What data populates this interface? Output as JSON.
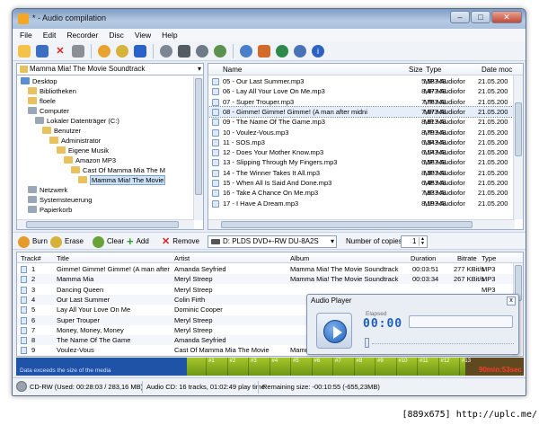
{
  "window": {
    "title": "* - Audio compilation",
    "controls": [
      "–",
      "□",
      "✕"
    ]
  },
  "menu": [
    "File",
    "Edit",
    "Recorder",
    "Disc",
    "View",
    "Help"
  ],
  "folder_combo": "Mamma Mia! The Movie Soundtrack",
  "tree": [
    {
      "label": "Desktop",
      "icon": "blue"
    },
    {
      "label": "Bibliotheken",
      "icon": "yellow"
    },
    {
      "label": "floele",
      "icon": "yellow"
    },
    {
      "label": "Computer",
      "icon": "grey"
    },
    {
      "label": "Lokaler Datenträger (C:)",
      "icon": "grey"
    },
    {
      "label": "Benutzer",
      "icon": "yellow"
    },
    {
      "label": "Administrator",
      "icon": "yellow"
    },
    {
      "label": "Eigene Musik",
      "icon": "yellow"
    },
    {
      "label": "Amazon MP3",
      "icon": "yellow"
    },
    {
      "label": "Cast Of Mamma Mia The M",
      "icon": "yellow"
    },
    {
      "label": "Mamma Mia! The Movie",
      "icon": "yellow"
    },
    {
      "label": "Netzwerk",
      "icon": "grey"
    },
    {
      "label": "Systemsteuerung",
      "icon": "grey"
    },
    {
      "label": "Papierkorb",
      "icon": "grey"
    }
  ],
  "file_headers": {
    "name": "Name",
    "size": "Size",
    "type": "Type",
    "date": "Date moc"
  },
  "files": [
    {
      "name": "05 - Our Last Summer.mp3",
      "size": "5,58 MB",
      "type": "MP3-Audiofor",
      "date": "21.05.200"
    },
    {
      "name": "06 - Lay All Your Love On Me.mp3",
      "size": "8,47 MB",
      "type": "MP3-Audiofor",
      "date": "21.05.200"
    },
    {
      "name": "07 - Super Trouper.mp3",
      "size": "7,76 MB",
      "type": "MP3-Audiofor",
      "date": "21.05.200"
    },
    {
      "name": "08 - Gimme! Gimme! Gimme! (A man after midni",
      "size": "7,67 MB",
      "type": "MP3-Audiofor",
      "date": "21.05.200"
    },
    {
      "name": "09 - The Name Of The Game.mp3",
      "size": "8,81 MB",
      "type": "MP3-Audiofor",
      "date": "21.05.200"
    },
    {
      "name": "10 - Voulez-Vous.mp3",
      "size": "8,79 MB",
      "type": "MP3-Audiofor",
      "date": "21.05.200"
    },
    {
      "name": "11 - SOS.mp3",
      "size": "6,34 MB",
      "type": "MP3-Audiofor",
      "date": "21.05.200"
    },
    {
      "name": "12 - Does Your Mother Know.mp3",
      "size": "6,14 MB",
      "type": "MP3-Audiofor",
      "date": "21.05.200"
    },
    {
      "name": "13 - Slipping Through My Fingers.mp3",
      "size": "6,56 MB",
      "type": "MP3-Audiofor",
      "date": "21.05.200"
    },
    {
      "name": "14 - The Winner Takes It All.mp3",
      "size": "8,30 MB",
      "type": "MP3-Audiofor",
      "date": "21.05.200"
    },
    {
      "name": "15 - When All Is Said And Done.mp3",
      "size": "6,45 MB",
      "type": "MP3-Audiofor",
      "date": "21.05.200"
    },
    {
      "name": "16 - Take A Chance On Me.mp3",
      "size": "7,83 MB",
      "type": "MP3-Audiofor",
      "date": "21.05.200"
    },
    {
      "name": "17 - I Have A Dream.mp3",
      "size": "8,19 MB",
      "type": "MP3-Audiofor",
      "date": "21.05.200"
    }
  ],
  "actions": {
    "burn": "Burn",
    "erase": "Erase",
    "clear": "Clear",
    "add": "Add",
    "remove": "Remove"
  },
  "drive": "D: PLDS DVD+-RW DU-8A2S",
  "copies_label": "Number of copies:",
  "copies_value": "1",
  "track_headers": {
    "track": "Track#",
    "title": "Title",
    "artist": "Artist",
    "album": "Album",
    "duration": "Duration",
    "bitrate": "Bitrate",
    "type": "Type"
  },
  "tracks": [
    {
      "n": "1",
      "title": "Gimme! Gimme! Gimme! (A man after m",
      "artist": "Amanda Seyfried",
      "album": "Mamma Mia! The Movie Soundtrack",
      "duration": "00:03:51",
      "bitrate": "277 KBit/s",
      "type": "MP3"
    },
    {
      "n": "2",
      "title": "Mamma Mia",
      "artist": "Meryl Streep",
      "album": "Mamma Mia! The Movie Soundtrack",
      "duration": "00:03:34",
      "bitrate": "267 KBit/s",
      "type": "MP3"
    },
    {
      "n": "3",
      "title": "Dancing Queen",
      "artist": "Meryl Streep",
      "album": "",
      "duration": "",
      "bitrate": "",
      "type": "MP3"
    },
    {
      "n": "4",
      "title": "Our Last Summer",
      "artist": "Colin Firth",
      "album": "",
      "duration": "",
      "bitrate": "",
      "type": "MP3"
    },
    {
      "n": "5",
      "title": "Lay All Your Love On Me",
      "artist": "Dominic Cooper",
      "album": "",
      "duration": "",
      "bitrate": "",
      "type": "MP3"
    },
    {
      "n": "6",
      "title": "Super Trouper",
      "artist": "Meryl Streep",
      "album": "",
      "duration": "",
      "bitrate": "",
      "type": "MP3"
    },
    {
      "n": "7",
      "title": "Money, Money, Money",
      "artist": "Meryl Streep",
      "album": "",
      "duration": "",
      "bitrate": "",
      "type": "MP3"
    },
    {
      "n": "8",
      "title": "The Name Of The Game",
      "artist": "Amanda Seyfried",
      "album": "",
      "duration": "",
      "bitrate": "",
      "type": "MP3"
    },
    {
      "n": "9",
      "title": "Voulez-Vous",
      "artist": "Cast Of Mamma Mia The Movie",
      "album": "Mamma Mia! The Movie Soundtrack",
      "duration": "00:04:35",
      "bitrate": "272 KBit/s",
      "type": "MP3"
    }
  ],
  "player": {
    "title": "Audio Player",
    "close": "x",
    "elapsed_label": "Elapsed",
    "elapsed": "00:00"
  },
  "capacity": {
    "warning": "Data exceeds the size of the media",
    "ticks": [
      "#1",
      "#2",
      "#3",
      "#4",
      "#5",
      "#6",
      "#7",
      "#8",
      "#9",
      "#10",
      "#11",
      "#12",
      "#13"
    ],
    "time": "90min:53sec"
  },
  "status": {
    "media": "CD-RW (Used: 00:28:03 / 283,16 MB)",
    "info": "Audio CD: 16 tracks, 01:02:49 play time",
    "remaining": "Remaining size: -00:10:55 (-655,23MB)"
  },
  "footer": "[889x675] http://uplc.me/",
  "colors": {
    "title_start": "#7d9cc6",
    "capacity_blue": "#1f53a8",
    "capacity_green": "#8bb022",
    "overflow_time": "#ff3a2a"
  }
}
